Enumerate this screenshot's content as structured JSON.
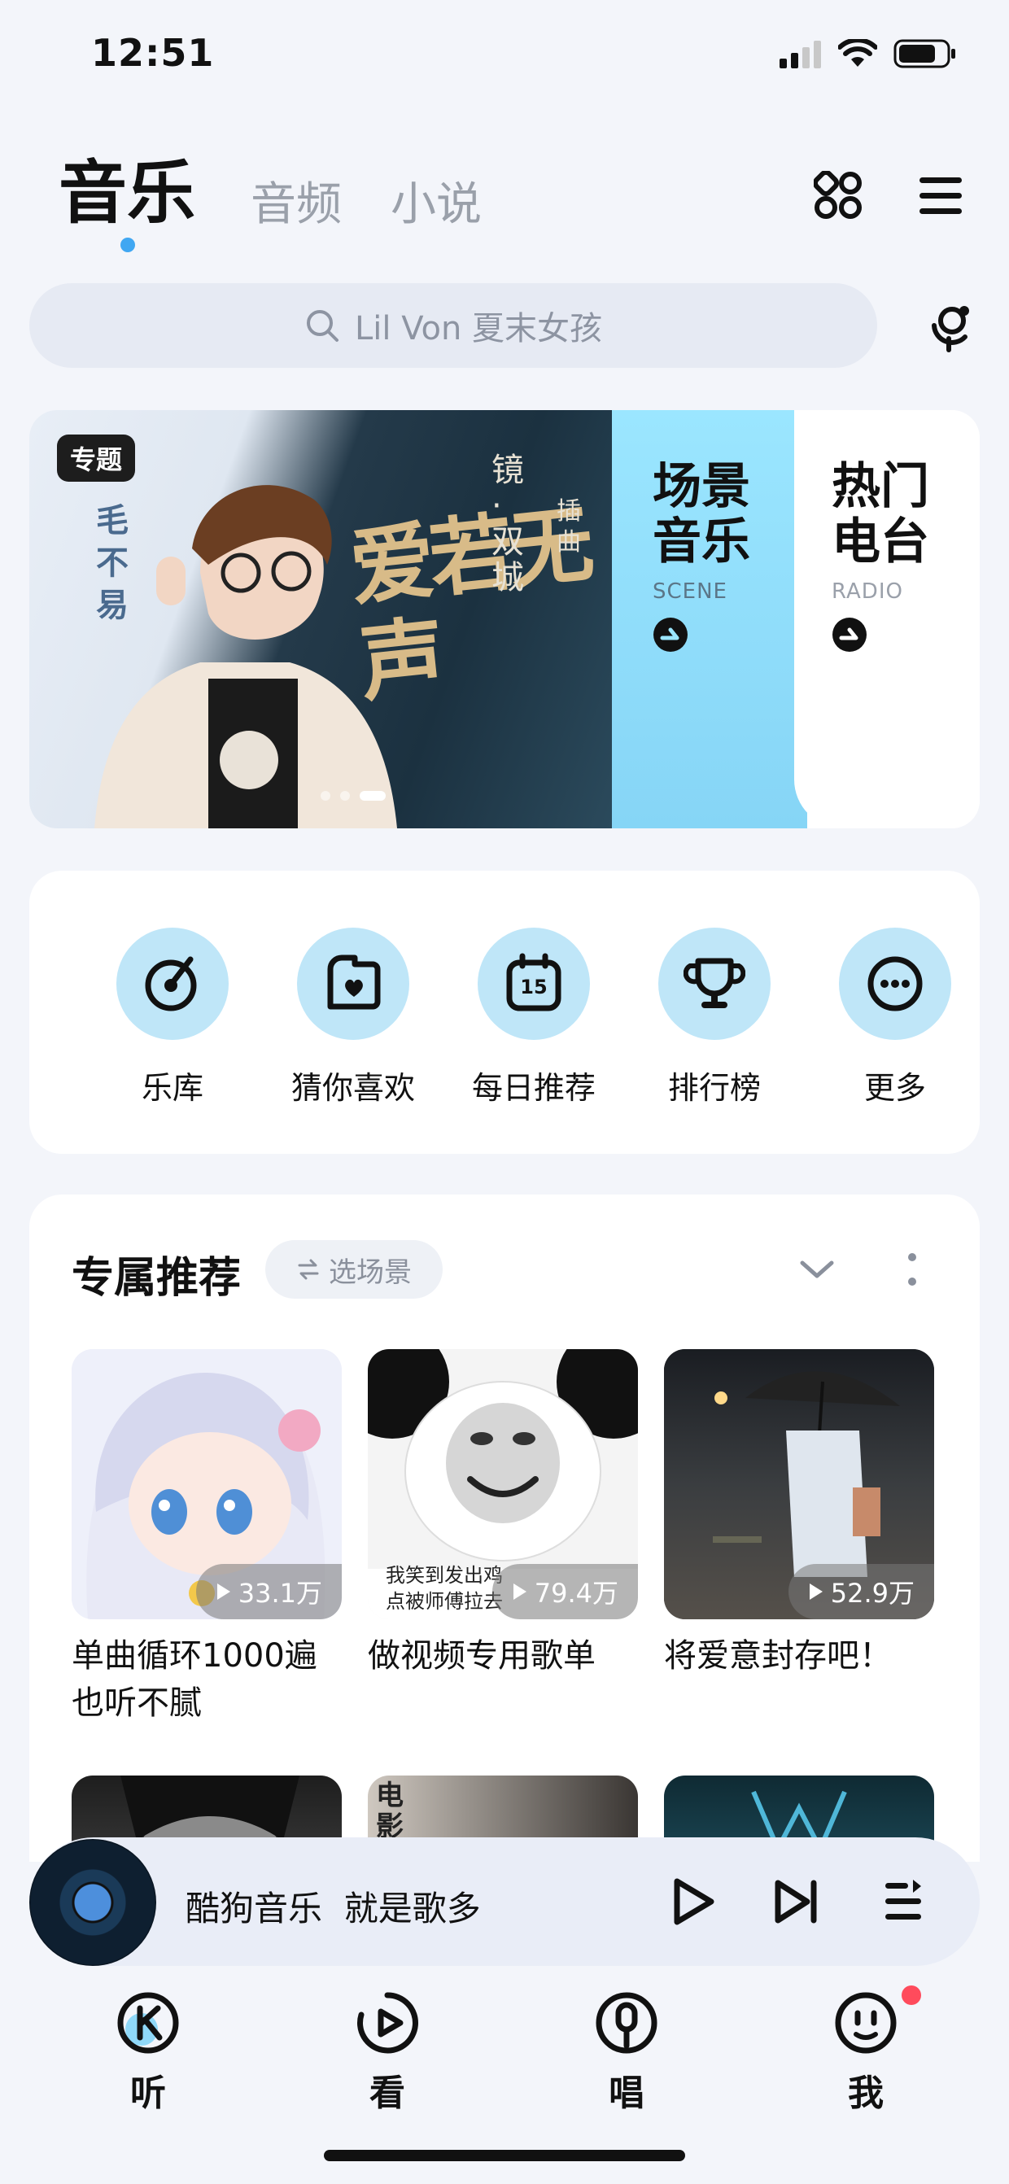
{
  "status": {
    "time": "12:51"
  },
  "tabs": [
    "音乐",
    "音频",
    "小说"
  ],
  "search": {
    "placeholder": "Lil Von 夏末女孩"
  },
  "banner": {
    "tag": "专题",
    "singer": "毛不易",
    "song": "爱若无声",
    "drama": "镜·双城",
    "caption": "插曲",
    "scene": {
      "title": "场景音乐",
      "sub": "SCENE"
    },
    "radio": {
      "title": "热门电台",
      "sub": "RADIO"
    }
  },
  "quick_actions": [
    {
      "label": "乐库",
      "icon": "music-disc-icon"
    },
    {
      "label": "猜你喜欢",
      "icon": "heart-box-icon"
    },
    {
      "label": "每日推荐",
      "icon": "calendar-15-icon",
      "calendar_day": "15"
    },
    {
      "label": "排行榜",
      "icon": "trophy-icon"
    },
    {
      "label": "更多",
      "icon": "more-icon"
    }
  ],
  "recommend": {
    "title": "专属推荐",
    "scene_chip": "选场景",
    "playlists": [
      {
        "name": "单曲循环1000遍也听不腻",
        "plays": "33.1万",
        "cover_text": ""
      },
      {
        "name": "做视频专用歌单",
        "plays": "79.4万",
        "cover_text": "我笑到发出鸡\n点被师傅拉去"
      },
      {
        "name": "将爱意封存吧！",
        "plays": "52.9万",
        "cover_text": ""
      }
    ],
    "row2_cover_text": "电影"
  },
  "player": {
    "title": "酷狗音乐  就是歌多"
  },
  "bottom_nav": [
    {
      "label": "听",
      "icon": "listen-icon"
    },
    {
      "label": "看",
      "icon": "watch-icon"
    },
    {
      "label": "唱",
      "icon": "sing-icon"
    },
    {
      "label": "我",
      "icon": "me-icon"
    }
  ],
  "colors": {
    "accent": "#40a7f2",
    "quick_circle": "#bfe6f8",
    "scene_card": "#9be6ff",
    "badge": "#ff4b5c"
  }
}
